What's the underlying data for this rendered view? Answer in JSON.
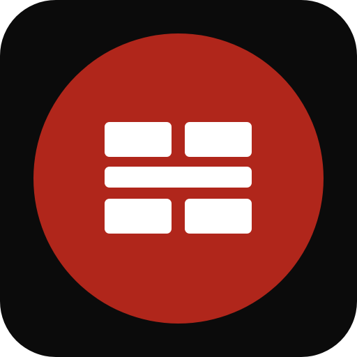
{
  "icon": {
    "name": "grid-layout-app-icon",
    "symbol": "grid-layout-icon",
    "colors": {
      "background": "#0b0b0b",
      "badge": "#b0261b",
      "glyph": "#ffffff"
    }
  }
}
